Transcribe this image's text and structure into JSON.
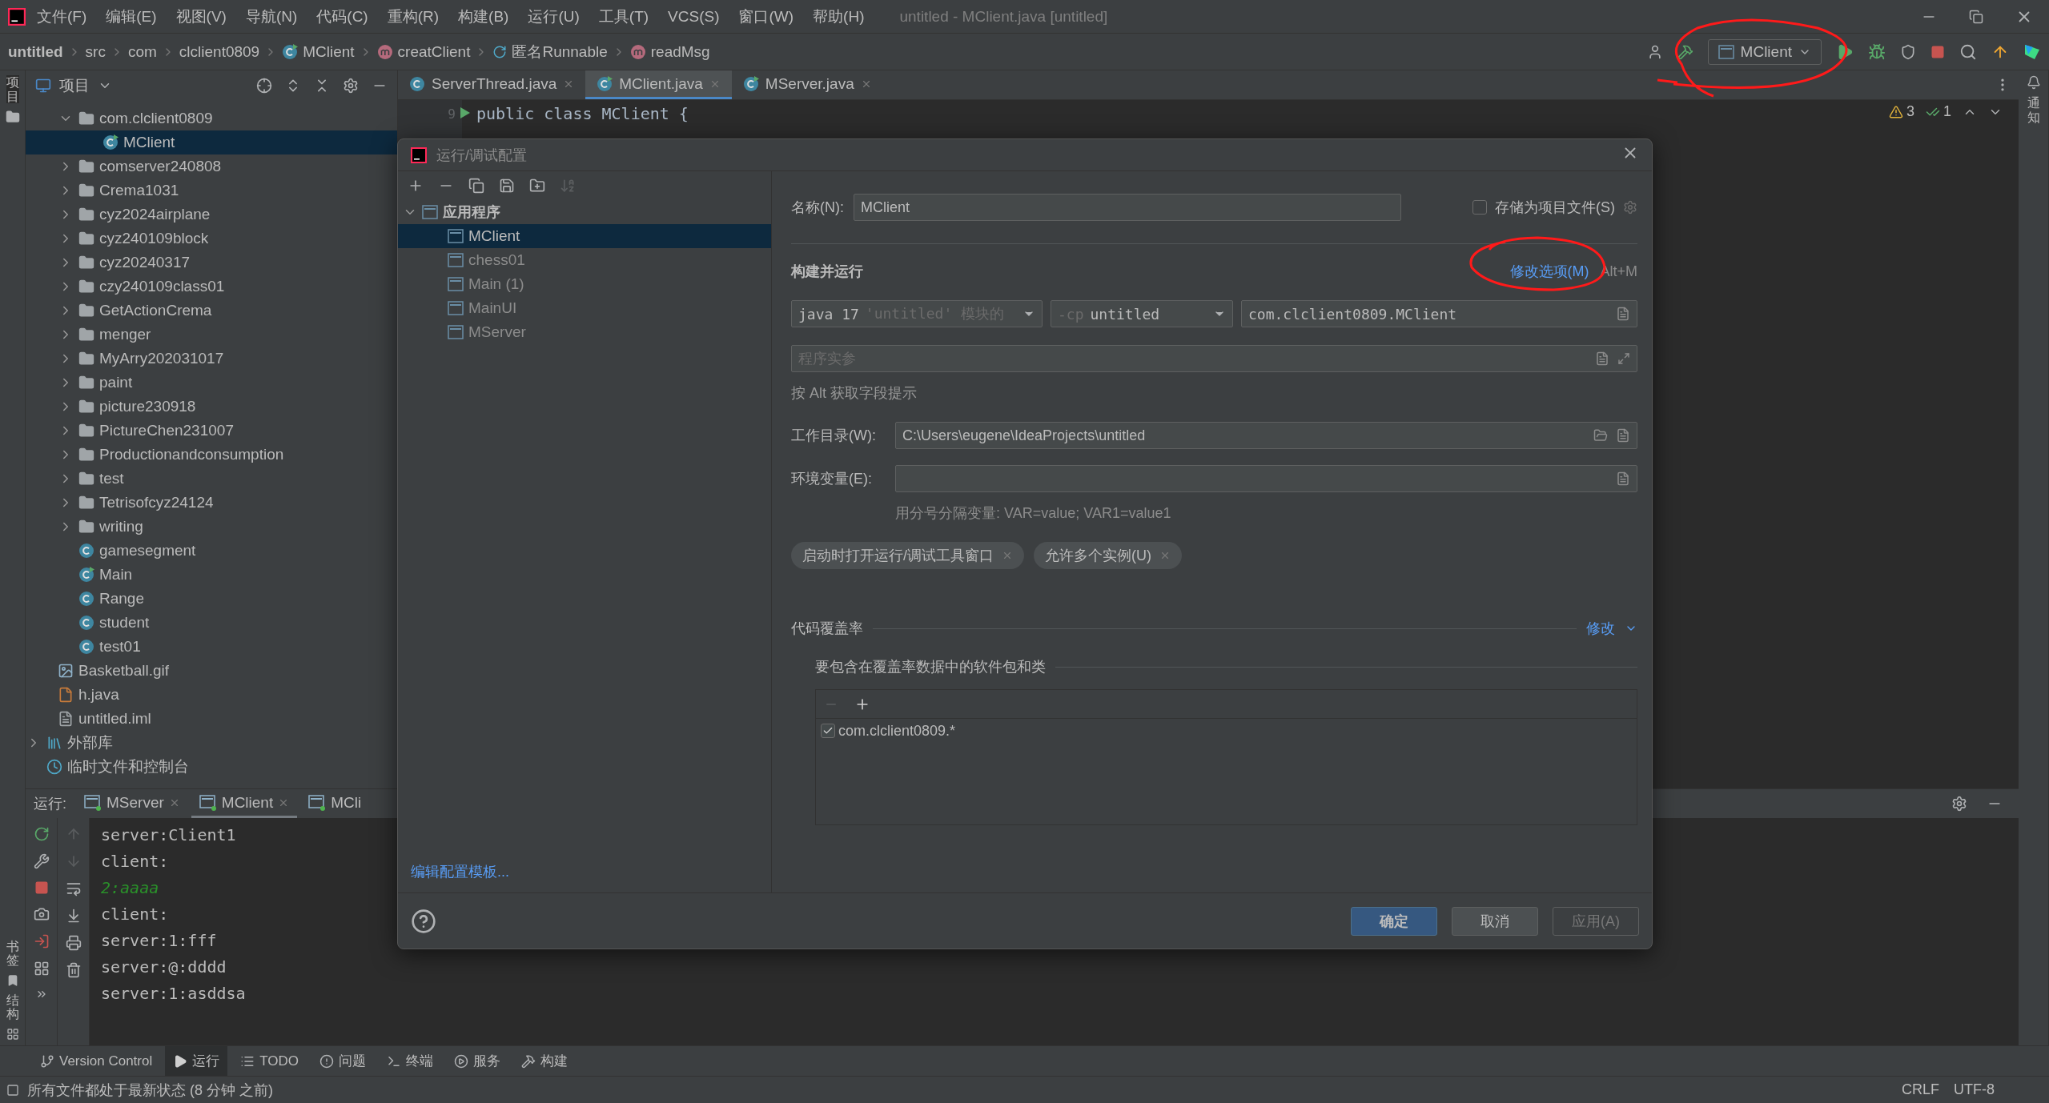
{
  "menu_bar": {
    "items": [
      "文件(F)",
      "编辑(E)",
      "视图(V)",
      "导航(N)",
      "代码(C)",
      "重构(R)",
      "构建(B)",
      "运行(U)",
      "工具(T)",
      "VCS(S)",
      "窗口(W)",
      "帮助(H)"
    ],
    "title": "untitled - MClient.java [untitled]"
  },
  "breadcrumb": [
    {
      "label": "untitled",
      "kind": "project"
    },
    {
      "label": "src",
      "kind": "plain"
    },
    {
      "label": "com",
      "kind": "plain"
    },
    {
      "label": "clclient0809",
      "kind": "plain"
    },
    {
      "label": "MClient",
      "kind": "class"
    },
    {
      "label": "creatClient",
      "kind": "method"
    },
    {
      "label": "匿名Runnable",
      "kind": "anonymous"
    },
    {
      "label": "readMsg",
      "kind": "method"
    }
  ],
  "run_config": {
    "label": "MClient"
  },
  "project_panel": {
    "title": "项目",
    "packages": [
      {
        "label": "com.clclient0809",
        "kind": "folder",
        "expanded": true,
        "selected": false,
        "children": [
          {
            "label": "MClient",
            "kind": "runnable",
            "selected": true
          }
        ]
      },
      {
        "label": "comserver240808",
        "kind": "folder",
        "expanded": false,
        "selected": false
      },
      {
        "label": "Crema1031",
        "kind": "folder",
        "expanded": false,
        "selected": false
      },
      {
        "label": "cyz2024airplane",
        "kind": "folder",
        "expanded": false,
        "selected": false
      },
      {
        "label": "cyz240109block",
        "kind": "folder",
        "expanded": false,
        "selected": false
      },
      {
        "label": "cyz20240317",
        "kind": "folder",
        "expanded": false,
        "selected": false
      },
      {
        "label": "czy240109class01",
        "kind": "folder",
        "expanded": false,
        "selected": false
      },
      {
        "label": "GetActionCrema",
        "kind": "folder",
        "expanded": false,
        "selected": false
      },
      {
        "label": "menger",
        "kind": "folder",
        "expanded": false,
        "selected": false
      },
      {
        "label": "MyArry202031017",
        "kind": "folder",
        "expanded": false,
        "selected": false
      },
      {
        "label": "paint",
        "kind": "folder",
        "expanded": false,
        "selected": false
      },
      {
        "label": "picture230918",
        "kind": "folder",
        "expanded": false,
        "selected": false
      },
      {
        "label": "PictureChen231007",
        "kind": "folder",
        "expanded": false,
        "selected": false
      },
      {
        "label": "Productionandconsumption",
        "kind": "folder",
        "expanded": false,
        "selected": false
      },
      {
        "label": "test",
        "kind": "folder",
        "expanded": false,
        "selected": false
      },
      {
        "label": "Tetrisofcyz24124",
        "kind": "folder",
        "expanded": false,
        "selected": false
      },
      {
        "label": "writing",
        "kind": "folder",
        "expanded": false,
        "selected": false
      },
      {
        "label": "gamesegment",
        "kind": "class",
        "selected": false
      },
      {
        "label": "Main",
        "kind": "runnable",
        "selected": false
      },
      {
        "label": "Range",
        "kind": "class",
        "selected": false
      },
      {
        "label": "student",
        "kind": "class",
        "selected": false
      },
      {
        "label": "test01",
        "kind": "class",
        "selected": false
      }
    ],
    "files": [
      {
        "label": "Basketball.gif",
        "kind": "image",
        "selected": false
      },
      {
        "label": "h.java",
        "kind": "java",
        "selected": false
      },
      {
        "label": "untitled.iml",
        "kind": "iml",
        "selected": false
      }
    ],
    "roots": [
      {
        "label": "外部库",
        "kind": "library",
        "expanded": false,
        "selected": false
      },
      {
        "label": "临时文件和控制台",
        "kind": "scratch",
        "selected": false
      }
    ]
  },
  "editor_tabs": [
    {
      "label": "ServerThread.java",
      "kind": "class",
      "selected": false
    },
    {
      "label": "MClient.java",
      "kind": "runnable",
      "selected": true
    },
    {
      "label": "MServer.java",
      "kind": "runnable",
      "selected": false
    }
  ],
  "editor": {
    "lines": [
      {
        "number": "9",
        "code": "public class MClient {"
      }
    ],
    "warnings": "3",
    "passed": "1"
  },
  "left_stripe": {
    "top": "项目",
    "bottom": [
      "书签",
      "结构"
    ]
  },
  "right_stripe": {
    "label": "通知"
  },
  "dialog": {
    "title": "运行/调试配置",
    "tree": {
      "group": "应用程序",
      "expanded": true,
      "items": [
        {
          "label": "MClient",
          "selected": true
        },
        {
          "label": "chess01",
          "selected": false
        },
        {
          "label": "Main (1)",
          "selected": false
        },
        {
          "label": "MainUI",
          "selected": false
        },
        {
          "label": "MServer",
          "selected": false
        }
      ]
    },
    "templates_link": "编辑配置模板...",
    "name_label": "名称(N):",
    "name_value": "MClient",
    "store_option": {
      "label": "存储为项目文件(S)",
      "checked": false
    },
    "build_section": "构建并运行",
    "modify_options": "修改选项(M)",
    "modify_shortcut": "Alt+M",
    "jre": "java 17",
    "jre_hint": "'untitled' 模块的",
    "cp_flag": "-cp",
    "cp_value": "untitled",
    "main_class": "com.clclient0809.MClient",
    "args_placeholder": "程序实参",
    "alt_hint": "按 Alt 获取字段提示",
    "workdir_label": "工作目录(W):",
    "workdir_value": "C:\\Users\\eugene\\IdeaProjects\\untitled",
    "env_label": "环境变量(E):",
    "env_hint": "用分号分隔变量: VAR=value; VAR1=value1",
    "chips": [
      "启动时打开运行/调试工具窗口",
      "允许多个实例(U)"
    ],
    "coverage_section": "代码覆盖率",
    "coverage_modify": "修改",
    "coverage_label": "要包含在覆盖率数据中的软件包和类",
    "patterns": [
      {
        "label": "com.clclient0809.*",
        "checked": true
      }
    ],
    "buttons": [
      {
        "label": "确定",
        "kind": "primary"
      },
      {
        "label": "取消",
        "kind": "normal"
      },
      {
        "label": "应用(A)",
        "kind": "disabled"
      }
    ]
  },
  "run_panel": {
    "label": "运行:",
    "tabs": [
      {
        "label": "MServer",
        "selected": false
      },
      {
        "label": "MClient",
        "selected": true
      },
      {
        "label": "MCli",
        "selected": false
      }
    ],
    "console": [
      {
        "text": "server:Client1",
        "kind": "output"
      },
      {
        "text": "client:",
        "kind": "output"
      },
      {
        "text": "2:aaaa",
        "kind": "input"
      },
      {
        "text": "client:",
        "kind": "output"
      },
      {
        "text": "server:1:fff",
        "kind": "output"
      },
      {
        "text": "server:@:dddd",
        "kind": "output"
      },
      {
        "text": "server:1:asddsa",
        "kind": "output"
      }
    ]
  },
  "tool_tabs": [
    {
      "label": "Version Control",
      "kind": "vcs",
      "selected": false
    },
    {
      "label": "运行",
      "kind": "run",
      "selected": true
    },
    {
      "label": "TODO",
      "kind": "todo",
      "selected": false
    },
    {
      "label": "问题",
      "kind": "problems",
      "selected": false
    },
    {
      "label": "终端",
      "kind": "terminal",
      "selected": false
    },
    {
      "label": "服务",
      "kind": "services",
      "selected": false
    },
    {
      "label": "构建",
      "kind": "build",
      "selected": false
    }
  ],
  "status_bar": {
    "message": "所有文件都处于最新状态 (8 分钟 之前)",
    "line_ending": "CRLF",
    "encoding": "UTF-8"
  }
}
